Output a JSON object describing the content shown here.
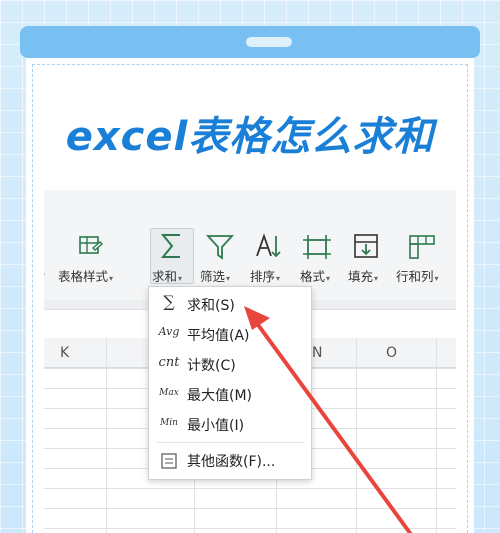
{
  "headline": "excel表格怎么求和",
  "ribbon": {
    "buttons": [
      {
        "label": "表格样式",
        "icon": "table-style-icon"
      },
      {
        "label": "求和",
        "icon": "sigma-icon"
      },
      {
        "label": "筛选",
        "icon": "filter-icon"
      },
      {
        "label": "排序",
        "icon": "sort-icon"
      },
      {
        "label": "格式",
        "icon": "format-icon"
      },
      {
        "label": "填充",
        "icon": "fill-icon"
      },
      {
        "label": "行和列",
        "icon": "rows-cols-icon"
      }
    ],
    "caret": "▾"
  },
  "columns": [
    "K",
    "N",
    "O"
  ],
  "dropdown": {
    "items": [
      {
        "icon": "∑",
        "label": "求和(S)"
      },
      {
        "icon": "Avg",
        "label": "平均值(A)"
      },
      {
        "icon": "cnt",
        "label": "计数(C)"
      },
      {
        "icon": "Max",
        "label": "最大值(M)"
      },
      {
        "icon": "Min",
        "label": "最小值(I)"
      },
      {
        "icon": "function-icon",
        "label": "其他函数(F)..."
      }
    ]
  },
  "colors": {
    "accent": "#1a7fd6",
    "arrow": "#e8453c",
    "card_top": "#78bff2"
  }
}
